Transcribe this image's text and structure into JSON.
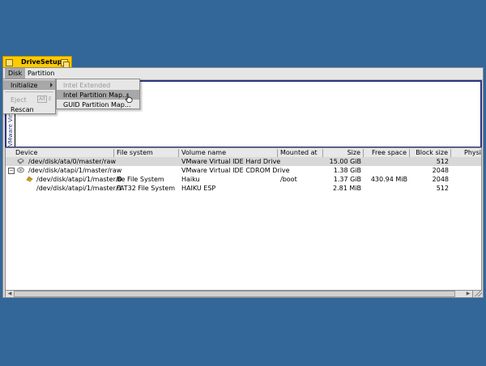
{
  "window": {
    "title": "DriveSetup"
  },
  "menubar": {
    "disk": "Disk",
    "partition": "Partition"
  },
  "disk_menu": {
    "initialize": "Initialize",
    "eject": "Eject",
    "eject_shortcut_key": "Alt",
    "eject_shortcut_letter": "E",
    "rescan": "Rescan"
  },
  "initialize_submenu": {
    "intel_extended": "Intel Extended Partition...",
    "intel_map": "Intel Partition Map...",
    "guid_map": "GUID Partition Map..."
  },
  "disk_map": {
    "label": "VMware Virtu"
  },
  "table": {
    "headers": [
      "Device",
      "File system",
      "Volume name",
      "Mounted at",
      "Size",
      "Free space",
      "Block size",
      "Physi"
    ],
    "rows": [
      {
        "device": "/dev/disk/ata/0/master/raw",
        "fs": "",
        "volume": "VMware Virtual IDE Hard Drive",
        "mount": "",
        "size": "15.00 GiB",
        "free": "",
        "block": "512",
        "icon": "hard-disk-icon"
      },
      {
        "device": "/dev/disk/atapi/1/master/raw",
        "fs": "",
        "volume": "VMware Virtual IDE CDROM Drive",
        "mount": "",
        "size": "1.38 GiB",
        "free": "",
        "block": "2048",
        "icon": "cdrom-drive-icon"
      },
      {
        "device": "/dev/disk/atapi/1/master/0",
        "fs": "Be File System",
        "volume": "Haiku",
        "mount": "/boot",
        "size": "1.37 GiB",
        "free": "430.94 MiB",
        "block": "2048",
        "icon": "haiku-volume-icon"
      },
      {
        "device": "/dev/disk/atapi/1/master/1",
        "fs": "FAT32 File System",
        "volume": "HAIKU ESP",
        "mount": "",
        "size": "2.81 MiB",
        "free": "",
        "block": "512",
        "icon": ""
      }
    ]
  },
  "colors": {
    "desktop": "#336699",
    "tab": "#ffcb00",
    "map_border": "#2b3680"
  }
}
